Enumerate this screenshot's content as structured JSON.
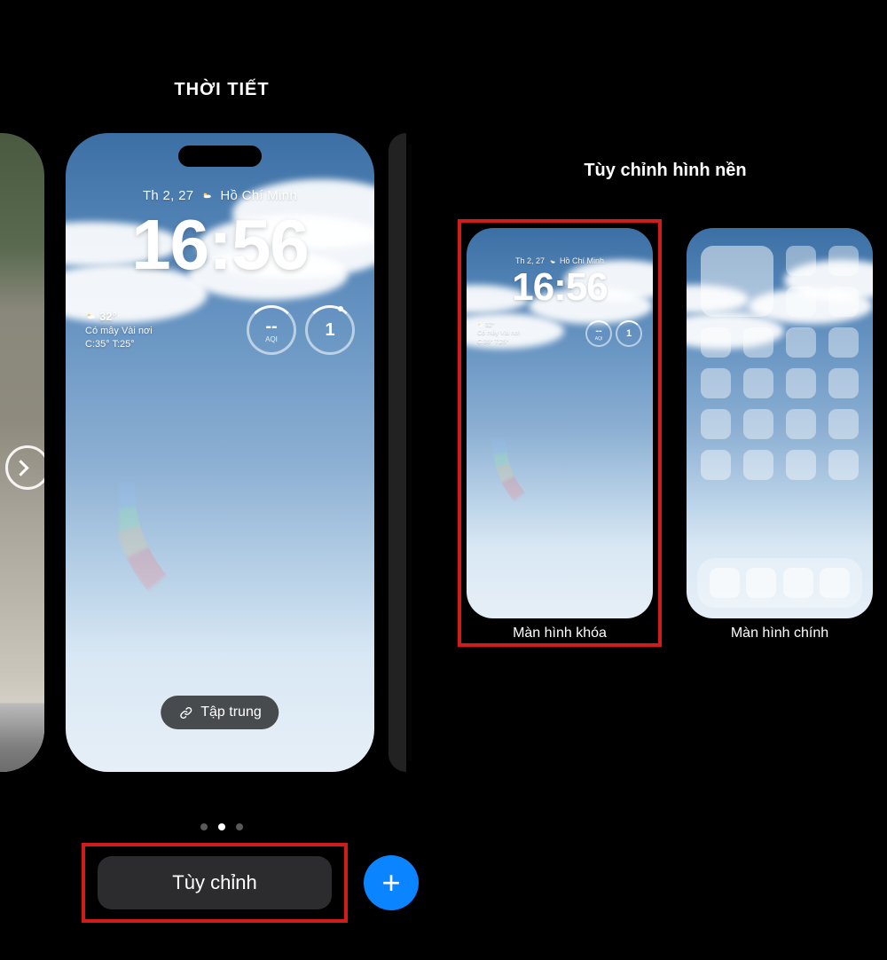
{
  "left": {
    "title": "THỜI TIẾT",
    "date": "Th 2, 27",
    "location": "Hồ Chí Minh",
    "time": "16:56",
    "weather": {
      "temp": "32°",
      "summary": "Có mây Vài nơi",
      "hi_lo": "C:35° T:25°"
    },
    "widget1": {
      "value": "--",
      "sub": "AQI"
    },
    "widget2": {
      "value": "1",
      "sub": ""
    },
    "focus_label": "Tập trung",
    "customize_label": "Tùy chỉnh"
  },
  "right": {
    "title": "Tùy chỉnh hình nền",
    "lock": {
      "caption": "Màn hình khóa",
      "date": "Th 2, 27",
      "location": "Hồ Chí Minh",
      "time": "16:56",
      "weather_temp": "32°",
      "weather_summary": "Có mây Vài nơi",
      "weather_hilo": "C:35° T:25°",
      "widget1": {
        "value": "--",
        "sub": "AQI"
      },
      "widget2": {
        "value": "1",
        "sub": ""
      }
    },
    "home": {
      "caption": "Màn hình chính"
    }
  }
}
